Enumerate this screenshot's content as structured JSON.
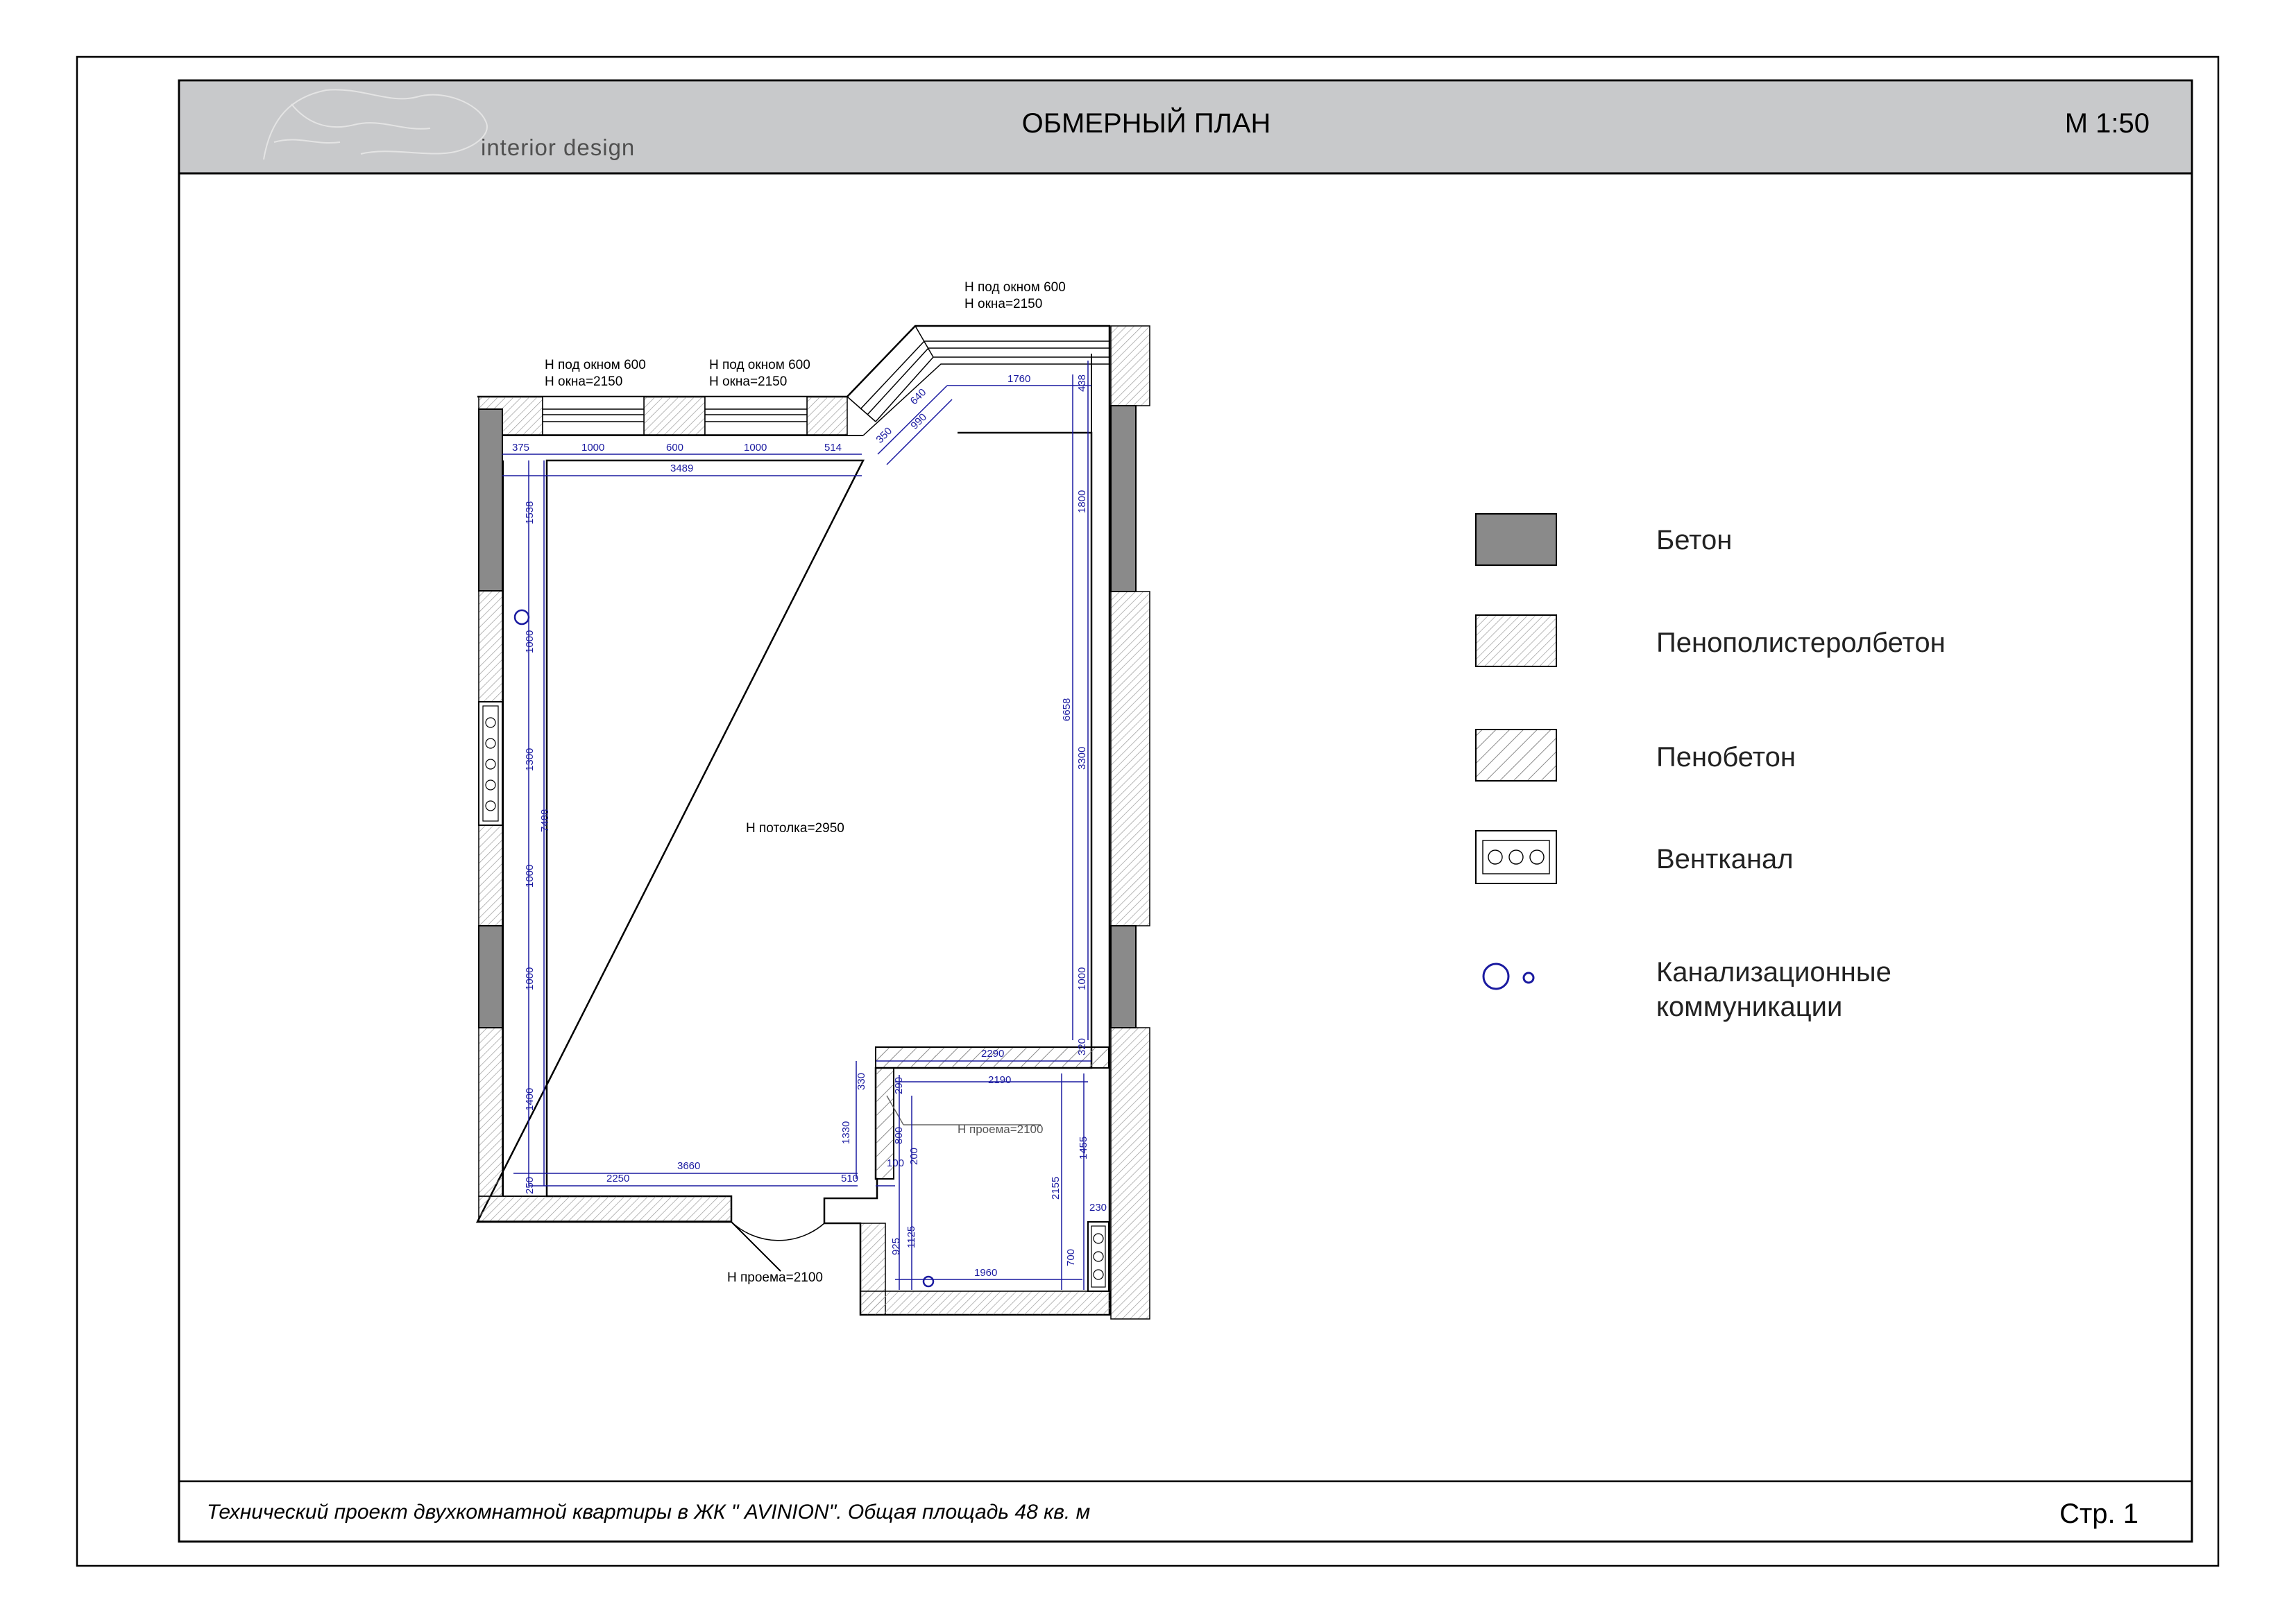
{
  "header": {
    "logo_text": "interior design",
    "title": "ОБМЕРНЫЙ ПЛАН",
    "scale": "М 1:50"
  },
  "footer": {
    "project": "Технический проект двухкомнатной квартиры в ЖК \" AVINION\". Общая площадь 48 кв. м",
    "page": "Стр. 1"
  },
  "plan": {
    "ceiling": "Н потолка=2950",
    "windows": [
      {
        "sill": "Н под окном 600",
        "height": "Н окна=2150"
      },
      {
        "sill": "Н под окном 600",
        "height": "Н окна=2150"
      },
      {
        "sill": "Н под окном 600",
        "height": "Н окна=2150"
      }
    ],
    "openings": {
      "main_door": "Н проема=2100",
      "bath_door": "Н проема=2100"
    },
    "dims": {
      "top_375": "375",
      "top_1000a": "1000",
      "top_600": "600",
      "top_1000b": "1000",
      "top_514": "514",
      "top_3489": "3489",
      "diag_350": "350",
      "diag_640": "640",
      "diag_990": "990",
      "top_1760": "1760",
      "right_438": "438",
      "right_1800": "1800",
      "right_6658": "6658",
      "right_3300": "3300",
      "right_1000": "1000",
      "right_320": "320",
      "left_1538": "1538",
      "left_1000a": "1000",
      "left_1300": "1300",
      "left_7488": "7488",
      "left_1000b": "1000",
      "left_1000c": "1000",
      "left_1400": "1400",
      "left_250": "250",
      "bot_3660": "3660",
      "bot_2250": "2250",
      "bot_510": "510",
      "bath_2290": "2290",
      "bath_2190": "2190",
      "bath_330": "330",
      "bath_1330": "1330",
      "bath_290": "290",
      "bath_800": "800",
      "bath_100": "100",
      "bath_200": "200",
      "bath_2155": "2155",
      "bath_1455": "1455",
      "bath_230": "230",
      "bath_925": "925",
      "bath_1125": "1125",
      "bath_700": "700",
      "bath_1960": "1960"
    }
  },
  "legend": [
    {
      "label": "Бетон",
      "swatch": "concrete"
    },
    {
      "label": "Пенополистеролбетон",
      "swatch": "polystyrene"
    },
    {
      "label": "Пенобетон",
      "swatch": "foam"
    },
    {
      "label": "Вентканал",
      "swatch": "vent"
    },
    {
      "label_line1": "Канализационные",
      "label_line2": "коммуникации",
      "swatch": "sewer"
    }
  ],
  "colors": {
    "header_bg": "#c8c9cb",
    "concrete": "#8a8a8a",
    "dimension": "#1a1aa0",
    "ink": "#000000"
  }
}
